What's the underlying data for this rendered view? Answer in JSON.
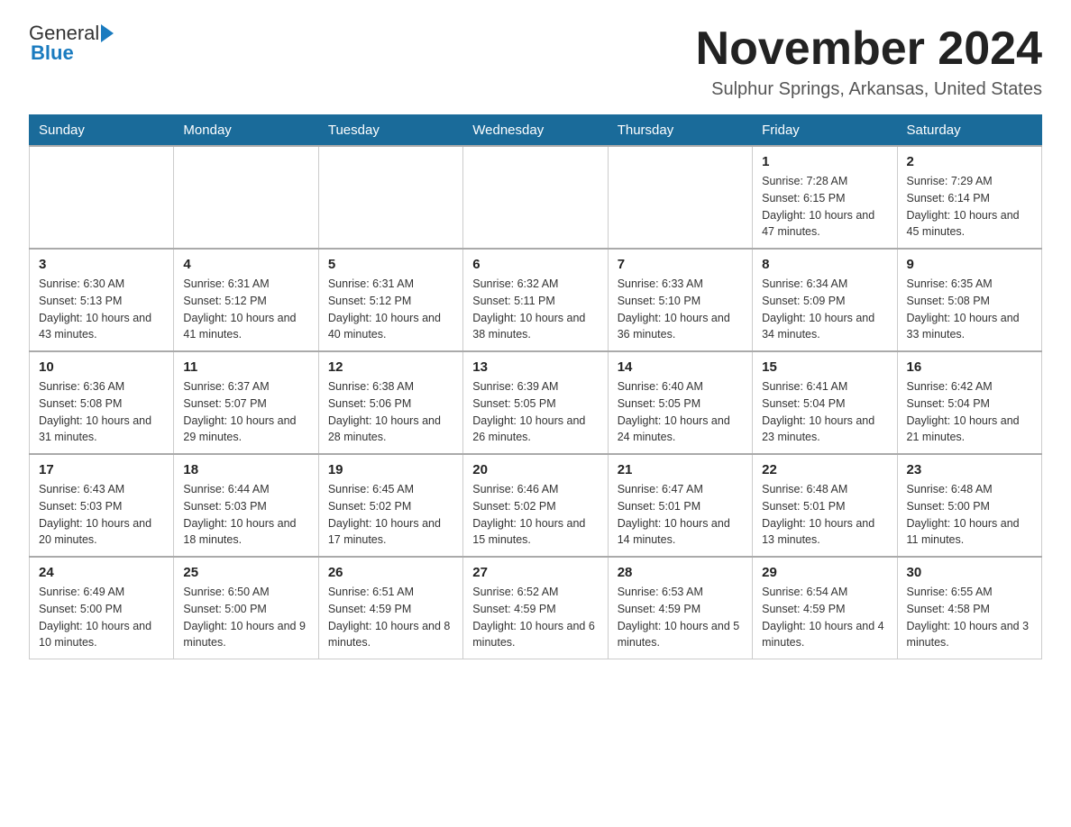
{
  "logo": {
    "general_text": "General",
    "blue_text": "Blue"
  },
  "title": "November 2024",
  "location": "Sulphur Springs, Arkansas, United States",
  "weekdays": [
    "Sunday",
    "Monday",
    "Tuesday",
    "Wednesday",
    "Thursday",
    "Friday",
    "Saturday"
  ],
  "weeks": [
    [
      {
        "day": "",
        "info": ""
      },
      {
        "day": "",
        "info": ""
      },
      {
        "day": "",
        "info": ""
      },
      {
        "day": "",
        "info": ""
      },
      {
        "day": "",
        "info": ""
      },
      {
        "day": "1",
        "info": "Sunrise: 7:28 AM\nSunset: 6:15 PM\nDaylight: 10 hours and 47 minutes."
      },
      {
        "day": "2",
        "info": "Sunrise: 7:29 AM\nSunset: 6:14 PM\nDaylight: 10 hours and 45 minutes."
      }
    ],
    [
      {
        "day": "3",
        "info": "Sunrise: 6:30 AM\nSunset: 5:13 PM\nDaylight: 10 hours and 43 minutes."
      },
      {
        "day": "4",
        "info": "Sunrise: 6:31 AM\nSunset: 5:12 PM\nDaylight: 10 hours and 41 minutes."
      },
      {
        "day": "5",
        "info": "Sunrise: 6:31 AM\nSunset: 5:12 PM\nDaylight: 10 hours and 40 minutes."
      },
      {
        "day": "6",
        "info": "Sunrise: 6:32 AM\nSunset: 5:11 PM\nDaylight: 10 hours and 38 minutes."
      },
      {
        "day": "7",
        "info": "Sunrise: 6:33 AM\nSunset: 5:10 PM\nDaylight: 10 hours and 36 minutes."
      },
      {
        "day": "8",
        "info": "Sunrise: 6:34 AM\nSunset: 5:09 PM\nDaylight: 10 hours and 34 minutes."
      },
      {
        "day": "9",
        "info": "Sunrise: 6:35 AM\nSunset: 5:08 PM\nDaylight: 10 hours and 33 minutes."
      }
    ],
    [
      {
        "day": "10",
        "info": "Sunrise: 6:36 AM\nSunset: 5:08 PM\nDaylight: 10 hours and 31 minutes."
      },
      {
        "day": "11",
        "info": "Sunrise: 6:37 AM\nSunset: 5:07 PM\nDaylight: 10 hours and 29 minutes."
      },
      {
        "day": "12",
        "info": "Sunrise: 6:38 AM\nSunset: 5:06 PM\nDaylight: 10 hours and 28 minutes."
      },
      {
        "day": "13",
        "info": "Sunrise: 6:39 AM\nSunset: 5:05 PM\nDaylight: 10 hours and 26 minutes."
      },
      {
        "day": "14",
        "info": "Sunrise: 6:40 AM\nSunset: 5:05 PM\nDaylight: 10 hours and 24 minutes."
      },
      {
        "day": "15",
        "info": "Sunrise: 6:41 AM\nSunset: 5:04 PM\nDaylight: 10 hours and 23 minutes."
      },
      {
        "day": "16",
        "info": "Sunrise: 6:42 AM\nSunset: 5:04 PM\nDaylight: 10 hours and 21 minutes."
      }
    ],
    [
      {
        "day": "17",
        "info": "Sunrise: 6:43 AM\nSunset: 5:03 PM\nDaylight: 10 hours and 20 minutes."
      },
      {
        "day": "18",
        "info": "Sunrise: 6:44 AM\nSunset: 5:03 PM\nDaylight: 10 hours and 18 minutes."
      },
      {
        "day": "19",
        "info": "Sunrise: 6:45 AM\nSunset: 5:02 PM\nDaylight: 10 hours and 17 minutes."
      },
      {
        "day": "20",
        "info": "Sunrise: 6:46 AM\nSunset: 5:02 PM\nDaylight: 10 hours and 15 minutes."
      },
      {
        "day": "21",
        "info": "Sunrise: 6:47 AM\nSunset: 5:01 PM\nDaylight: 10 hours and 14 minutes."
      },
      {
        "day": "22",
        "info": "Sunrise: 6:48 AM\nSunset: 5:01 PM\nDaylight: 10 hours and 13 minutes."
      },
      {
        "day": "23",
        "info": "Sunrise: 6:48 AM\nSunset: 5:00 PM\nDaylight: 10 hours and 11 minutes."
      }
    ],
    [
      {
        "day": "24",
        "info": "Sunrise: 6:49 AM\nSunset: 5:00 PM\nDaylight: 10 hours and 10 minutes."
      },
      {
        "day": "25",
        "info": "Sunrise: 6:50 AM\nSunset: 5:00 PM\nDaylight: 10 hours and 9 minutes."
      },
      {
        "day": "26",
        "info": "Sunrise: 6:51 AM\nSunset: 4:59 PM\nDaylight: 10 hours and 8 minutes."
      },
      {
        "day": "27",
        "info": "Sunrise: 6:52 AM\nSunset: 4:59 PM\nDaylight: 10 hours and 6 minutes."
      },
      {
        "day": "28",
        "info": "Sunrise: 6:53 AM\nSunset: 4:59 PM\nDaylight: 10 hours and 5 minutes."
      },
      {
        "day": "29",
        "info": "Sunrise: 6:54 AM\nSunset: 4:59 PM\nDaylight: 10 hours and 4 minutes."
      },
      {
        "day": "30",
        "info": "Sunrise: 6:55 AM\nSunset: 4:58 PM\nDaylight: 10 hours and 3 minutes."
      }
    ]
  ]
}
